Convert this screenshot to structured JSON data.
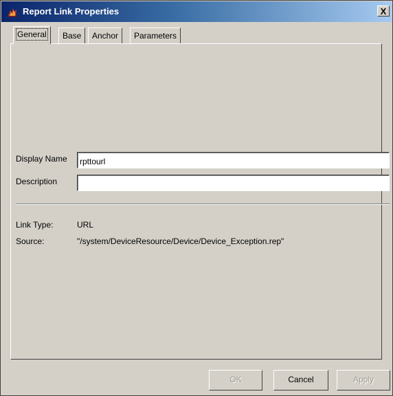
{
  "window": {
    "title": "Report Link Properties",
    "close_glyph": "X",
    "icon": "report-app-icon"
  },
  "tabs": [
    {
      "label": "General",
      "active": true
    },
    {
      "label": "Base",
      "active": false
    },
    {
      "label": "Anchor",
      "active": false
    },
    {
      "label": "Parameters",
      "active": false
    }
  ],
  "general": {
    "display_name_label": "Display Name",
    "display_name_value": "rpttourl",
    "description_label": "Description",
    "description_value": "",
    "link_type_label": "Link Type:",
    "link_type_value": "URL",
    "source_label": "Source:",
    "source_value": "\"/system/DeviceResource/Device/Device_Exception.rep\""
  },
  "buttons": {
    "ok": "OK",
    "cancel": "Cancel",
    "apply": "Apply"
  }
}
